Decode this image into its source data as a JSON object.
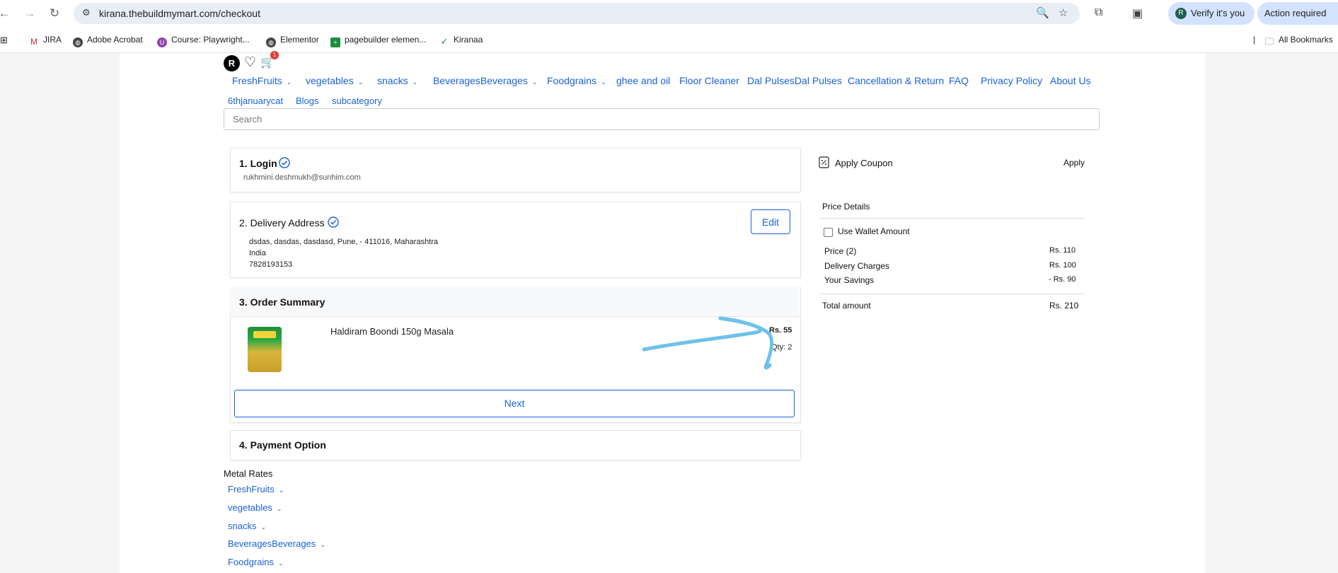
{
  "browser": {
    "url": "kirana.thebuildmymart.com/checkout",
    "verify_label": "Verify it's you",
    "verify_avatar": "R",
    "action_label": "Action required",
    "bookmarks": [
      "JIRA",
      "Adobe Acrobat",
      "Course: Playwright...",
      "Elementor",
      "pagebuilder elemen...",
      "Kiranaa"
    ],
    "all_bookmarks": "All Bookmarks"
  },
  "header": {
    "avatar_letter": "R",
    "cart_count": "1",
    "nav_row1": [
      {
        "label": "FreshFruits",
        "dropdown": true
      },
      {
        "label": "vegetables",
        "dropdown": true
      },
      {
        "label": "snacks",
        "dropdown": true
      },
      {
        "label": "BeveragesBeverages",
        "dropdown": true
      },
      {
        "label": "Foodgrains",
        "dropdown": true
      },
      {
        "label": "ghee and oil",
        "dropdown": false
      },
      {
        "label": "Floor Cleaner",
        "dropdown": false
      },
      {
        "label": "Dal PulsesDal Pulses",
        "dropdown": false
      },
      {
        "label": "Cancellation & Return",
        "dropdown": false
      },
      {
        "label": "FAQ",
        "dropdown": false
      },
      {
        "label": "Privacy Policy",
        "dropdown": false
      },
      {
        "label": "About Us",
        "dropdown": false
      }
    ],
    "nav_row2": [
      "6thjanuarycat",
      "Blogs",
      "subcategory"
    ],
    "search_placeholder": "Search"
  },
  "checkout": {
    "login": {
      "title": "1. Login",
      "email": "rukhmini.deshmukh@sunhim.com"
    },
    "address": {
      "title": "2. Delivery Address",
      "line1": "dsdas, dasdas, dasdasd, Pune, - 411016, Maharashtra",
      "line2": "India",
      "phone": "7828193153",
      "edit_label": "Edit"
    },
    "summary": {
      "title": "3. Order Summary",
      "product_name": "Haldiram Boondi 150g Masala",
      "product_price": "Rs. 55",
      "product_qty": "Qty: 2",
      "next_label": "Next"
    },
    "payment": {
      "title": "4. Payment Option"
    }
  },
  "sidebar": {
    "coupon_label": "Apply Coupon",
    "apply_label": "Apply",
    "price_details_title": "Price Details",
    "wallet_label": "Use Wallet Amount",
    "rows": [
      {
        "label": "Price (2)",
        "value": "Rs. 110"
      },
      {
        "label": "Delivery Charges",
        "value": "Rs. 100"
      },
      {
        "label": "Your Savings",
        "value": "- Rs. 90"
      }
    ],
    "total_label": "Total amount",
    "total_value": "Rs. 210"
  },
  "footer": {
    "heading": "Metal Rates",
    "links": [
      "FreshFruits",
      "vegetables",
      "snacks",
      "BeveragesBeverages",
      "Foodgrains"
    ]
  },
  "colors": {
    "link": "#1a62d6",
    "annotation": "#6ec1ea"
  }
}
